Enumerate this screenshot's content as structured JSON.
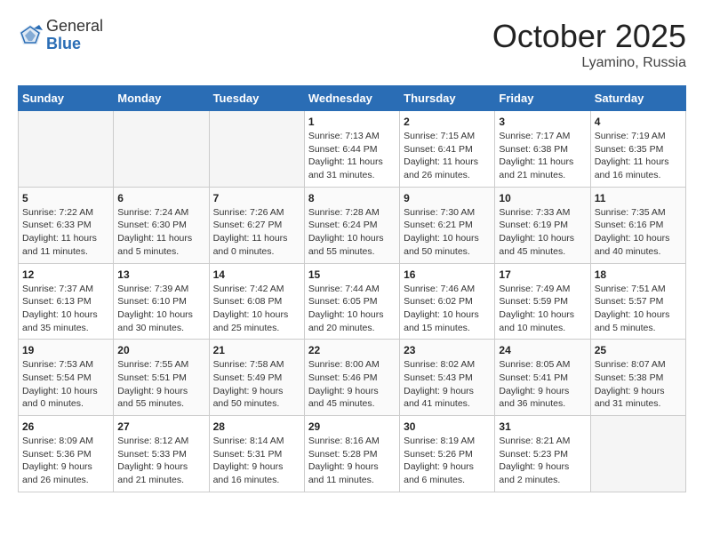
{
  "header": {
    "logo_general": "General",
    "logo_blue": "Blue",
    "title": "October 2025",
    "location": "Lyamino, Russia"
  },
  "weekdays": [
    "Sunday",
    "Monday",
    "Tuesday",
    "Wednesday",
    "Thursday",
    "Friday",
    "Saturday"
  ],
  "weeks": [
    [
      {
        "day": "",
        "info": ""
      },
      {
        "day": "",
        "info": ""
      },
      {
        "day": "",
        "info": ""
      },
      {
        "day": "1",
        "info": "Sunrise: 7:13 AM\nSunset: 6:44 PM\nDaylight: 11 hours\nand 31 minutes."
      },
      {
        "day": "2",
        "info": "Sunrise: 7:15 AM\nSunset: 6:41 PM\nDaylight: 11 hours\nand 26 minutes."
      },
      {
        "day": "3",
        "info": "Sunrise: 7:17 AM\nSunset: 6:38 PM\nDaylight: 11 hours\nand 21 minutes."
      },
      {
        "day": "4",
        "info": "Sunrise: 7:19 AM\nSunset: 6:35 PM\nDaylight: 11 hours\nand 16 minutes."
      }
    ],
    [
      {
        "day": "5",
        "info": "Sunrise: 7:22 AM\nSunset: 6:33 PM\nDaylight: 11 hours\nand 11 minutes."
      },
      {
        "day": "6",
        "info": "Sunrise: 7:24 AM\nSunset: 6:30 PM\nDaylight: 11 hours\nand 5 minutes."
      },
      {
        "day": "7",
        "info": "Sunrise: 7:26 AM\nSunset: 6:27 PM\nDaylight: 11 hours\nand 0 minutes."
      },
      {
        "day": "8",
        "info": "Sunrise: 7:28 AM\nSunset: 6:24 PM\nDaylight: 10 hours\nand 55 minutes."
      },
      {
        "day": "9",
        "info": "Sunrise: 7:30 AM\nSunset: 6:21 PM\nDaylight: 10 hours\nand 50 minutes."
      },
      {
        "day": "10",
        "info": "Sunrise: 7:33 AM\nSunset: 6:19 PM\nDaylight: 10 hours\nand 45 minutes."
      },
      {
        "day": "11",
        "info": "Sunrise: 7:35 AM\nSunset: 6:16 PM\nDaylight: 10 hours\nand 40 minutes."
      }
    ],
    [
      {
        "day": "12",
        "info": "Sunrise: 7:37 AM\nSunset: 6:13 PM\nDaylight: 10 hours\nand 35 minutes."
      },
      {
        "day": "13",
        "info": "Sunrise: 7:39 AM\nSunset: 6:10 PM\nDaylight: 10 hours\nand 30 minutes."
      },
      {
        "day": "14",
        "info": "Sunrise: 7:42 AM\nSunset: 6:08 PM\nDaylight: 10 hours\nand 25 minutes."
      },
      {
        "day": "15",
        "info": "Sunrise: 7:44 AM\nSunset: 6:05 PM\nDaylight: 10 hours\nand 20 minutes."
      },
      {
        "day": "16",
        "info": "Sunrise: 7:46 AM\nSunset: 6:02 PM\nDaylight: 10 hours\nand 15 minutes."
      },
      {
        "day": "17",
        "info": "Sunrise: 7:49 AM\nSunset: 5:59 PM\nDaylight: 10 hours\nand 10 minutes."
      },
      {
        "day": "18",
        "info": "Sunrise: 7:51 AM\nSunset: 5:57 PM\nDaylight: 10 hours\nand 5 minutes."
      }
    ],
    [
      {
        "day": "19",
        "info": "Sunrise: 7:53 AM\nSunset: 5:54 PM\nDaylight: 10 hours\nand 0 minutes."
      },
      {
        "day": "20",
        "info": "Sunrise: 7:55 AM\nSunset: 5:51 PM\nDaylight: 9 hours\nand 55 minutes."
      },
      {
        "day": "21",
        "info": "Sunrise: 7:58 AM\nSunset: 5:49 PM\nDaylight: 9 hours\nand 50 minutes."
      },
      {
        "day": "22",
        "info": "Sunrise: 8:00 AM\nSunset: 5:46 PM\nDaylight: 9 hours\nand 45 minutes."
      },
      {
        "day": "23",
        "info": "Sunrise: 8:02 AM\nSunset: 5:43 PM\nDaylight: 9 hours\nand 41 minutes."
      },
      {
        "day": "24",
        "info": "Sunrise: 8:05 AM\nSunset: 5:41 PM\nDaylight: 9 hours\nand 36 minutes."
      },
      {
        "day": "25",
        "info": "Sunrise: 8:07 AM\nSunset: 5:38 PM\nDaylight: 9 hours\nand 31 minutes."
      }
    ],
    [
      {
        "day": "26",
        "info": "Sunrise: 8:09 AM\nSunset: 5:36 PM\nDaylight: 9 hours\nand 26 minutes."
      },
      {
        "day": "27",
        "info": "Sunrise: 8:12 AM\nSunset: 5:33 PM\nDaylight: 9 hours\nand 21 minutes."
      },
      {
        "day": "28",
        "info": "Sunrise: 8:14 AM\nSunset: 5:31 PM\nDaylight: 9 hours\nand 16 minutes."
      },
      {
        "day": "29",
        "info": "Sunrise: 8:16 AM\nSunset: 5:28 PM\nDaylight: 9 hours\nand 11 minutes."
      },
      {
        "day": "30",
        "info": "Sunrise: 8:19 AM\nSunset: 5:26 PM\nDaylight: 9 hours\nand 6 minutes."
      },
      {
        "day": "31",
        "info": "Sunrise: 8:21 AM\nSunset: 5:23 PM\nDaylight: 9 hours\nand 2 minutes."
      },
      {
        "day": "",
        "info": ""
      }
    ]
  ]
}
